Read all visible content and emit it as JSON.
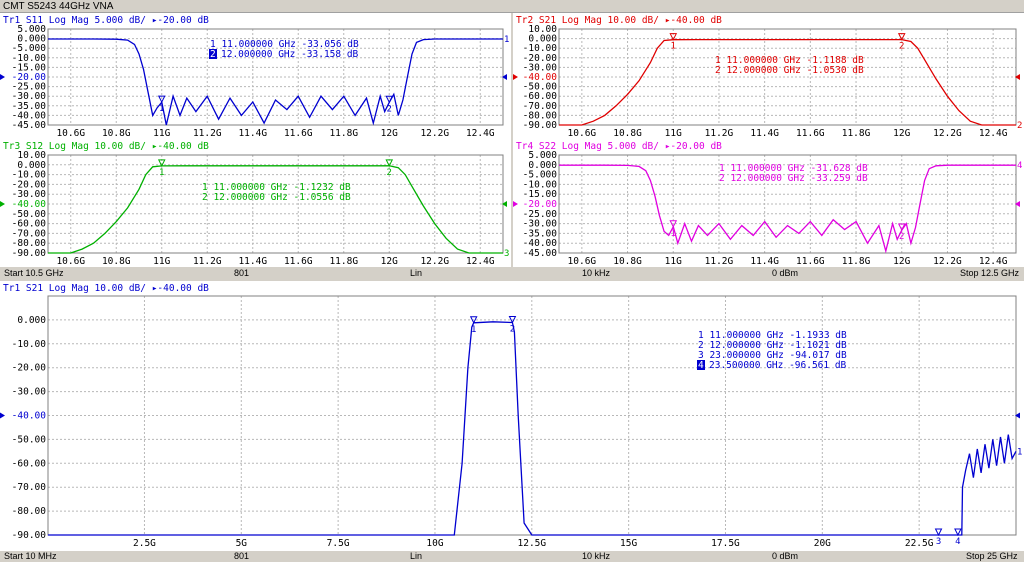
{
  "window": {
    "title": "CMT S5243 44GHz VNA"
  },
  "channel1": {
    "status": {
      "start": "Start 10.5 GHz",
      "points": "801",
      "sweep": "Lin",
      "ifbw": "10 kHz",
      "power": "0 dBm",
      "stop": "Stop 12.5 GHz"
    }
  },
  "channel2": {
    "status": {
      "start": "Start 10 MHz",
      "points": "801",
      "sweep": "Lin",
      "ifbw": "10 kHz",
      "power": "0 dBm",
      "stop": "Stop 25 GHz"
    }
  },
  "colors": {
    "tr1": "#0000d0",
    "tr2": "#e00000",
    "tr3": "#00b000",
    "tr4": "#e000e0",
    "grid": "#b8b8b8",
    "bg": "#ffffff"
  },
  "chart_data": [
    {
      "type": "line",
      "id": "tr1",
      "header": "Tr1 S11 Log Mag 5.000 dB/ ▸-20.00 dB",
      "xlim": [
        10.5,
        12.5
      ],
      "x_ticks": [
        "10.6G",
        "10.8G",
        "11G",
        "11.2G",
        "11.4G",
        "11.6G",
        "11.8G",
        "12G",
        "12.2G",
        "12.4G"
      ],
      "x_tick_values": [
        10.6,
        10.8,
        11.0,
        11.2,
        11.4,
        11.6,
        11.8,
        12.0,
        12.2,
        12.4
      ],
      "ylim": [
        -45,
        5
      ],
      "y_ticks": [
        "5.000",
        "0.000",
        "-5.000",
        "-10.00",
        "-15.00",
        "-20.00",
        "-25.00",
        "-30.00",
        "-35.00",
        "-40.00",
        "-45.00"
      ],
      "y_tick_values": [
        5,
        0,
        -5,
        -10,
        -15,
        -20,
        -25,
        -30,
        -35,
        -40,
        -45
      ],
      "ref_value": -20,
      "ref_label": "1",
      "color": "#0000d0",
      "markers": [
        {
          "n": "1",
          "text": "1 11.000000 GHz -33.056 dB",
          "active": false,
          "x": 11.0,
          "y": -33.056
        },
        {
          "n": "2",
          "text": "2 12.000000 GHz -33.158 dB",
          "active": true,
          "x": 12.0,
          "y": -33.158
        }
      ],
      "series": [
        {
          "x": [
            10.5,
            10.6,
            10.7,
            10.8,
            10.85,
            10.88,
            10.9,
            10.92,
            10.94,
            10.96,
            10.98,
            11.0,
            11.02,
            11.05,
            11.08,
            11.11,
            11.15,
            11.2,
            11.25,
            11.3,
            11.35,
            11.4,
            11.45,
            11.5,
            11.55,
            11.6,
            11.65,
            11.7,
            11.75,
            11.8,
            11.85,
            11.9,
            11.93,
            11.96,
            11.98,
            12.0,
            12.02,
            12.04,
            12.06,
            12.08,
            12.1,
            12.12,
            12.15,
            12.2,
            12.3,
            12.4,
            12.5
          ],
          "y": [
            -0.2,
            -0.2,
            -0.2,
            -0.3,
            -0.8,
            -3,
            -8,
            -16,
            -28,
            -40,
            -36,
            -33.1,
            -45,
            -30,
            -40,
            -31,
            -38,
            -30,
            -42,
            -31,
            -40,
            -33,
            -44,
            -32,
            -37,
            -30,
            -41,
            -30,
            -37,
            -30,
            -40,
            -31,
            -44,
            -30,
            -38,
            -33.2,
            -29,
            -40,
            -32,
            -20,
            -8,
            -2,
            -0.5,
            -0.2,
            -0.2,
            -0.2,
            -0.2
          ]
        }
      ]
    },
    {
      "type": "line",
      "id": "tr2",
      "header": "Tr2 S21 Log Mag 10.00 dB/ ▸-40.00 dB",
      "xlim": [
        10.5,
        12.5
      ],
      "x_ticks": [
        "10.6G",
        "10.8G",
        "11G",
        "11.2G",
        "11.4G",
        "11.6G",
        "11.8G",
        "12G",
        "12.2G",
        "12.4G"
      ],
      "x_tick_values": [
        10.6,
        10.8,
        11.0,
        11.2,
        11.4,
        11.6,
        11.8,
        12.0,
        12.2,
        12.4
      ],
      "ylim": [
        -90,
        10
      ],
      "y_ticks": [
        "10.00",
        "0.000",
        "-10.00",
        "-20.00",
        "-30.00",
        "-40.00",
        "-50.00",
        "-60.00",
        "-70.00",
        "-80.00",
        "-90.00"
      ],
      "y_tick_values": [
        10,
        0,
        -10,
        -20,
        -30,
        -40,
        -50,
        -60,
        -70,
        -80,
        -90
      ],
      "ref_value": -40,
      "ref_label": "2",
      "color": "#e00000",
      "markers": [
        {
          "n": "1",
          "text": "1 11.000000 GHz -1.1188 dB",
          "active": false,
          "x": 11.0,
          "y": -1.1188
        },
        {
          "n": "2",
          "text": "2 12.000000 GHz -1.0530 dB",
          "active": false,
          "x": 12.0,
          "y": -1.053
        }
      ],
      "series": [
        {
          "x": [
            10.5,
            10.6,
            10.65,
            10.7,
            10.75,
            10.8,
            10.85,
            10.9,
            10.93,
            10.96,
            11.0,
            11.1,
            11.3,
            11.5,
            11.7,
            11.9,
            12.0,
            12.04,
            12.07,
            12.1,
            12.15,
            12.2,
            12.25,
            12.3,
            12.35,
            12.4,
            12.5
          ],
          "y": [
            -90,
            -90,
            -86,
            -80,
            -70,
            -58,
            -44,
            -25,
            -10,
            -2,
            -1.1,
            -1.0,
            -1.0,
            -1.0,
            -1.0,
            -1.0,
            -1.05,
            -3,
            -10,
            -22,
            -42,
            -60,
            -75,
            -86,
            -90,
            -90,
            -90
          ]
        }
      ]
    },
    {
      "type": "line",
      "id": "tr3",
      "header": "Tr3 S12 Log Mag 10.00 dB/ ▸-40.00 dB",
      "xlim": [
        10.5,
        12.5
      ],
      "x_ticks": [
        "10.6G",
        "10.8G",
        "11G",
        "11.2G",
        "11.4G",
        "11.6G",
        "11.8G",
        "12G",
        "12.2G",
        "12.4G"
      ],
      "x_tick_values": [
        10.6,
        10.8,
        11.0,
        11.2,
        11.4,
        11.6,
        11.8,
        12.0,
        12.2,
        12.4
      ],
      "ylim": [
        -90,
        10
      ],
      "y_ticks": [
        "10.00",
        "0.000",
        "-10.00",
        "-20.00",
        "-30.00",
        "-40.00",
        "-50.00",
        "-60.00",
        "-70.00",
        "-80.00",
        "-90.00"
      ],
      "y_tick_values": [
        10,
        0,
        -10,
        -20,
        -30,
        -40,
        -50,
        -60,
        -70,
        -80,
        -90
      ],
      "ref_value": -40,
      "ref_label": "3",
      "color": "#00b000",
      "markers": [
        {
          "n": "1",
          "text": "1 11.000000 GHz -1.1232 dB",
          "active": false,
          "x": 11.0,
          "y": -1.1232
        },
        {
          "n": "2",
          "text": "2 12.000000 GHz -1.0556 dB",
          "active": false,
          "x": 12.0,
          "y": -1.0556
        }
      ],
      "series": [
        {
          "x": [
            10.5,
            10.6,
            10.65,
            10.7,
            10.75,
            10.8,
            10.85,
            10.9,
            10.93,
            10.96,
            11.0,
            11.1,
            11.3,
            11.5,
            11.7,
            11.9,
            12.0,
            12.04,
            12.07,
            12.1,
            12.15,
            12.2,
            12.25,
            12.3,
            12.35,
            12.4,
            12.5
          ],
          "y": [
            -90,
            -90,
            -86,
            -80,
            -70,
            -58,
            -44,
            -25,
            -10,
            -2,
            -1.1,
            -1.0,
            -1.0,
            -1.0,
            -1.0,
            -1.0,
            -1.05,
            -3,
            -10,
            -22,
            -42,
            -60,
            -75,
            -86,
            -90,
            -90,
            -90
          ]
        }
      ]
    },
    {
      "type": "line",
      "id": "tr4",
      "header": "Tr4 S22 Log Mag 5.000 dB/ ▸-20.00 dB",
      "xlim": [
        10.5,
        12.5
      ],
      "x_ticks": [
        "10.6G",
        "10.8G",
        "11G",
        "11.2G",
        "11.4G",
        "11.6G",
        "11.8G",
        "12G",
        "12.2G",
        "12.4G"
      ],
      "x_tick_values": [
        10.6,
        10.8,
        11.0,
        11.2,
        11.4,
        11.6,
        11.8,
        12.0,
        12.2,
        12.4
      ],
      "ylim": [
        -45,
        5
      ],
      "y_ticks": [
        "5.000",
        "0.000",
        "-5.000",
        "-10.00",
        "-15.00",
        "-20.00",
        "-25.00",
        "-30.00",
        "-35.00",
        "-40.00",
        "-45.00"
      ],
      "y_tick_values": [
        5,
        0,
        -5,
        -10,
        -15,
        -20,
        -25,
        -30,
        -35,
        -40,
        -45
      ],
      "ref_value": -20,
      "ref_label": "4",
      "color": "#e000e0",
      "markers": [
        {
          "n": "1",
          "text": "1 11.000000 GHz -31.628 dB",
          "active": false,
          "x": 11.0,
          "y": -31.628
        },
        {
          "n": "2",
          "text": "2 12.000000 GHz -33.259 dB",
          "active": false,
          "x": 12.0,
          "y": -33.259
        }
      ],
      "series": [
        {
          "x": [
            10.5,
            10.6,
            10.7,
            10.8,
            10.85,
            10.88,
            10.9,
            10.92,
            10.94,
            10.96,
            10.98,
            11.0,
            11.02,
            11.05,
            11.08,
            11.11,
            11.15,
            11.2,
            11.25,
            11.3,
            11.35,
            11.4,
            11.45,
            11.5,
            11.55,
            11.6,
            11.65,
            11.7,
            11.75,
            11.8,
            11.85,
            11.9,
            11.93,
            11.96,
            11.98,
            12.0,
            12.02,
            12.04,
            12.06,
            12.08,
            12.1,
            12.12,
            12.15,
            12.2,
            12.3,
            12.4,
            12.5
          ],
          "y": [
            -0.2,
            -0.2,
            -0.2,
            -0.3,
            -0.8,
            -3,
            -8,
            -16,
            -26,
            -34,
            -36,
            -31.6,
            -40,
            -30,
            -39,
            -31,
            -36,
            -30,
            -38,
            -31,
            -36,
            -29,
            -37,
            -31,
            -35,
            -29,
            -36,
            -28,
            -33,
            -29,
            -40,
            -31,
            -44,
            -30,
            -38,
            -33.3,
            -30,
            -40,
            -32,
            -20,
            -8,
            -2,
            -0.5,
            -0.2,
            -0.2,
            -0.2,
            -0.2
          ]
        }
      ]
    },
    {
      "type": "line",
      "id": "tr1-wide",
      "header": "Tr1 S21 Log Mag 10.00 dB/ ▸-40.00 dB",
      "xlim": [
        0.01,
        25
      ],
      "x_ticks": [
        "2.5G",
        "5G",
        "7.5G",
        "10G",
        "12.5G",
        "15G",
        "17.5G",
        "20G",
        "22.5G"
      ],
      "x_tick_values": [
        2.5,
        5,
        7.5,
        10,
        12.5,
        15,
        17.5,
        20,
        22.5
      ],
      "ylim": [
        -90,
        10
      ],
      "y_ticks": [
        "0.000",
        "-10.00",
        "-20.00",
        "-30.00",
        "-40.00",
        "-50.00",
        "-60.00",
        "-70.00",
        "-80.00",
        "-90.00"
      ],
      "y_tick_values": [
        0,
        -10,
        -20,
        -30,
        -40,
        -50,
        -60,
        -70,
        -80,
        -90
      ],
      "ref_value": -40,
      "ref_label": "1",
      "color": "#0000d0",
      "markers": [
        {
          "n": "1",
          "text": "1 11.000000 GHz -1.1933 dB",
          "active": false,
          "x": 11.0,
          "y": -1.1933
        },
        {
          "n": "2",
          "text": "2 12.000000 GHz -1.1021 dB",
          "active": false,
          "x": 12.0,
          "y": -1.1021
        },
        {
          "n": "3",
          "text": "3 23.000000 GHz -94.017 dB",
          "active": false,
          "x": 23.0,
          "y": -94.017
        },
        {
          "n": "4",
          "text": "4 23.500000 GHz -96.561 dB",
          "active": true,
          "x": 23.5,
          "y": -96.561
        }
      ],
      "series": [
        {
          "x": [
            0.01,
            10.5,
            10.7,
            10.85,
            10.95,
            11.0,
            11.5,
            12.0,
            12.05,
            12.15,
            12.3,
            12.5,
            23.6,
            23.62,
            23.7,
            23.8,
            23.9,
            24.0,
            24.1,
            24.2,
            24.3,
            24.4,
            24.5,
            24.6,
            24.7,
            24.8,
            24.9,
            25.0
          ],
          "y": [
            -90,
            -90,
            -60,
            -20,
            -3,
            -1.2,
            -0.8,
            -1.1,
            -5,
            -40,
            -85,
            -90,
            -90,
            -70,
            -63,
            -56,
            -66,
            -54,
            -64,
            -52,
            -62,
            -50,
            -61,
            -49,
            -60,
            -48,
            -58,
            -55
          ]
        }
      ]
    }
  ]
}
